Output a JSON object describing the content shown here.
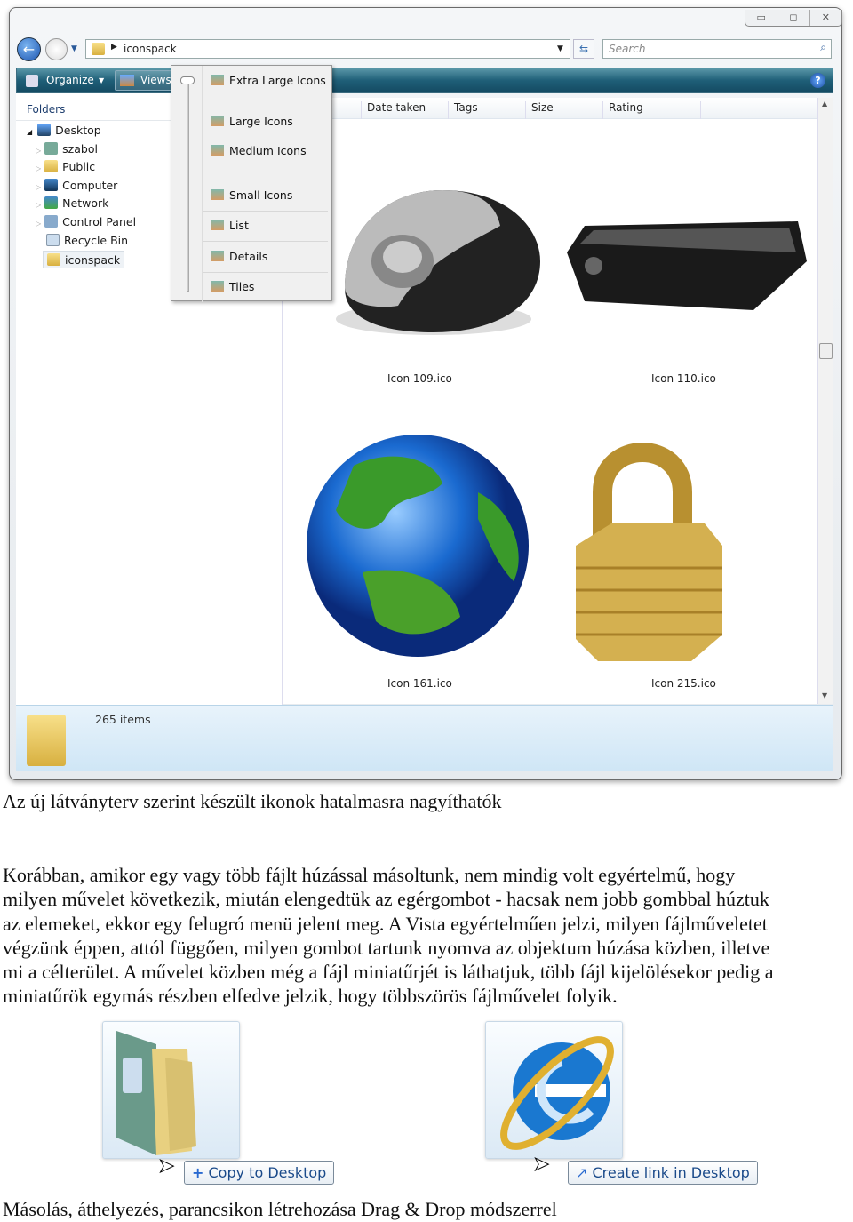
{
  "explorer": {
    "address": {
      "path": "iconspack"
    },
    "search": {
      "placeholder": "Search"
    },
    "toolbar": {
      "organize": "Organize",
      "views": "Views"
    },
    "window_controls": [
      "minimize-icon",
      "maximize-icon",
      "close-icon"
    ],
    "nav": {
      "header": "Folders",
      "items": [
        {
          "label": "Desktop",
          "icon": "desktop-icon"
        },
        {
          "label": "szabol",
          "icon": "user-folder-icon"
        },
        {
          "label": "Public",
          "icon": "folder-icon"
        },
        {
          "label": "Computer",
          "icon": "computer-icon"
        },
        {
          "label": "Network",
          "icon": "network-icon"
        },
        {
          "label": "Control Panel",
          "icon": "control-panel-icon"
        },
        {
          "label": "Recycle Bin",
          "icon": "recycle-bin-icon"
        },
        {
          "label": "iconspack",
          "icon": "folder-icon"
        }
      ]
    },
    "columns": [
      "Date taken",
      "Tags",
      "Size",
      "Rating"
    ],
    "files": [
      {
        "name": "Icon 109.ico",
        "icon": "mouse-icon"
      },
      {
        "name": "Icon 110.ico",
        "icon": "keyboard-icon"
      },
      {
        "name": "Icon 161.ico",
        "icon": "globe-icon"
      },
      {
        "name": "Icon 215.ico",
        "icon": "padlock-icon"
      }
    ],
    "status": {
      "count": "265 items"
    },
    "views_menu": {
      "items": [
        "Extra Large Icons",
        "Large Icons",
        "Medium Icons",
        "Small Icons",
        "List",
        "Details",
        "Tiles"
      ],
      "slider_level": "Extra Large Icons"
    }
  },
  "doc": {
    "caption1": "Az új látványterv szerint készült ikonok hatalmasra nagyíthatók",
    "paragraph_lines": [
      "Korábban, amikor egy vagy több fájlt húzással másoltunk, nem mindig volt egyértelmű, hogy",
      "milyen művelet következik, miután elengedtük az egérgombot - hacsak nem jobb gombbal húztuk",
      "az elemeket, ekkor egy felugró menü jelent meg. A Vista egyértelműen jelzi, milyen fájlműveletet",
      "végzünk éppen, attól függően, milyen gombot tartunk nyomva az objektum húzása közben, illetve",
      "mi a célterület. A művelet közben még a fájl miniatűrjét is láthatjuk, több fájl kijelölésekor pedig a",
      "miniatűrök egymás részben elfedve jelzik, hogy többszörös fájlművelet folyik."
    ],
    "drag_examples": [
      {
        "tooltip": "Copy to Desktop",
        "icon": "documents-folder-icon",
        "badge": "plus-icon"
      },
      {
        "tooltip": "Create link in Desktop",
        "icon": "internet-explorer-icon",
        "badge": "shortcut-arrow-icon"
      }
    ],
    "caption2": "Másolás, áthelyezés, parancsikon létrehozása Drag & Drop módszerrel"
  }
}
